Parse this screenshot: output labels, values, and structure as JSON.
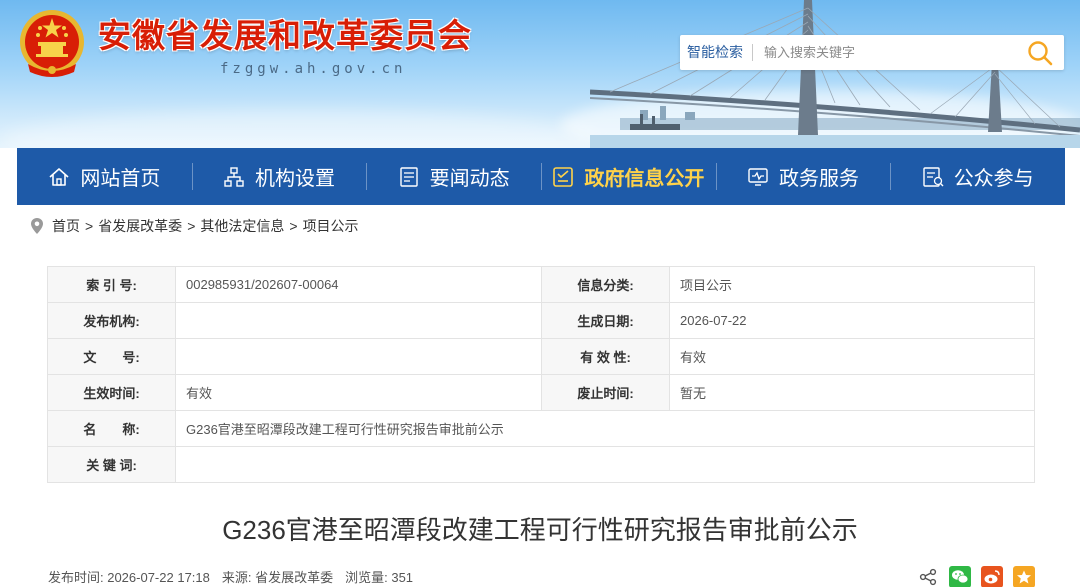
{
  "header": {
    "site_title": "安徽省发展和改革委员会",
    "site_domain": "fzggw.ah.gov.cn",
    "search": {
      "label": "智能检索",
      "placeholder": "输入搜索关键字"
    }
  },
  "nav": {
    "items": [
      {
        "label": "网站首页",
        "icon": "home-icon"
      },
      {
        "label": "机构设置",
        "icon": "org-chart-icon"
      },
      {
        "label": "要闻动态",
        "icon": "news-icon"
      },
      {
        "label": "政府信息公开",
        "icon": "info-disclosure-icon",
        "active": true
      },
      {
        "label": "政务服务",
        "icon": "monitor-icon"
      },
      {
        "label": "公众参与",
        "icon": "participation-icon"
      }
    ]
  },
  "breadcrumb": {
    "items": [
      "首页",
      "省发展改革委",
      "其他法定信息",
      "项目公示"
    ],
    "separator": ">"
  },
  "info": {
    "index_no_label": "索 引 号:",
    "index_no": "002985931/202607-00064",
    "category_label": "信息分类:",
    "category": "项目公示",
    "publisher_label": "发布机构:",
    "publisher": "",
    "created_label": "生成日期:",
    "created": "2026-07-22",
    "doc_no_label": "文　　号:",
    "doc_no": "",
    "validity_label": "有 效 性:",
    "validity": "有效",
    "effective_label": "生效时间:",
    "effective": "有效",
    "expire_label": "废止时间:",
    "expire": "暂无",
    "name_label": "名　　称:",
    "name": "G236官港至昭潭段改建工程可行性研究报告审批前公示",
    "keywords_label": "关 键 词:",
    "keywords": ""
  },
  "article": {
    "title": "G236官港至昭潭段改建工程可行性研究报告审批前公示",
    "publish_time": "发布时间: 2026-07-22 17:18",
    "source": "来源: 省发展改革委",
    "views": "浏览量: 351"
  },
  "share": {
    "icons": [
      "share-icon",
      "wechat-icon",
      "weibo-icon",
      "favorite-icon"
    ]
  },
  "colors": {
    "nav_bg": "#1e5aa8",
    "nav_active": "#ffd24a",
    "title_red": "#d81e06",
    "search_accent": "#f5a623",
    "wechat_green": "#2fb845",
    "weibo_orange": "#e8541e",
    "favorite_orange": "#f5a623"
  }
}
